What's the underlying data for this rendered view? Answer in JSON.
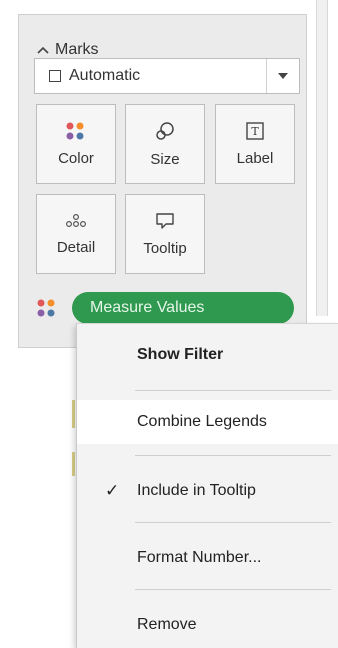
{
  "marks": {
    "header_label": "Marks",
    "mark_type": "Automatic",
    "tiles": {
      "color": "Color",
      "size": "Size",
      "label": "Label",
      "detail": "Detail",
      "tooltip": "Tooltip"
    },
    "pill_label": "Measure Values",
    "pill_color": "#2f9a4f"
  },
  "context_menu": {
    "items": [
      {
        "label": "Show Filter",
        "checked": false
      },
      {
        "label": "Combine Legends",
        "checked": false
      },
      {
        "label": "Include in Tooltip",
        "checked": true
      },
      {
        "label": "Format Number...",
        "checked": false
      },
      {
        "label": "Remove",
        "checked": false
      }
    ],
    "checkmark": "✓"
  }
}
